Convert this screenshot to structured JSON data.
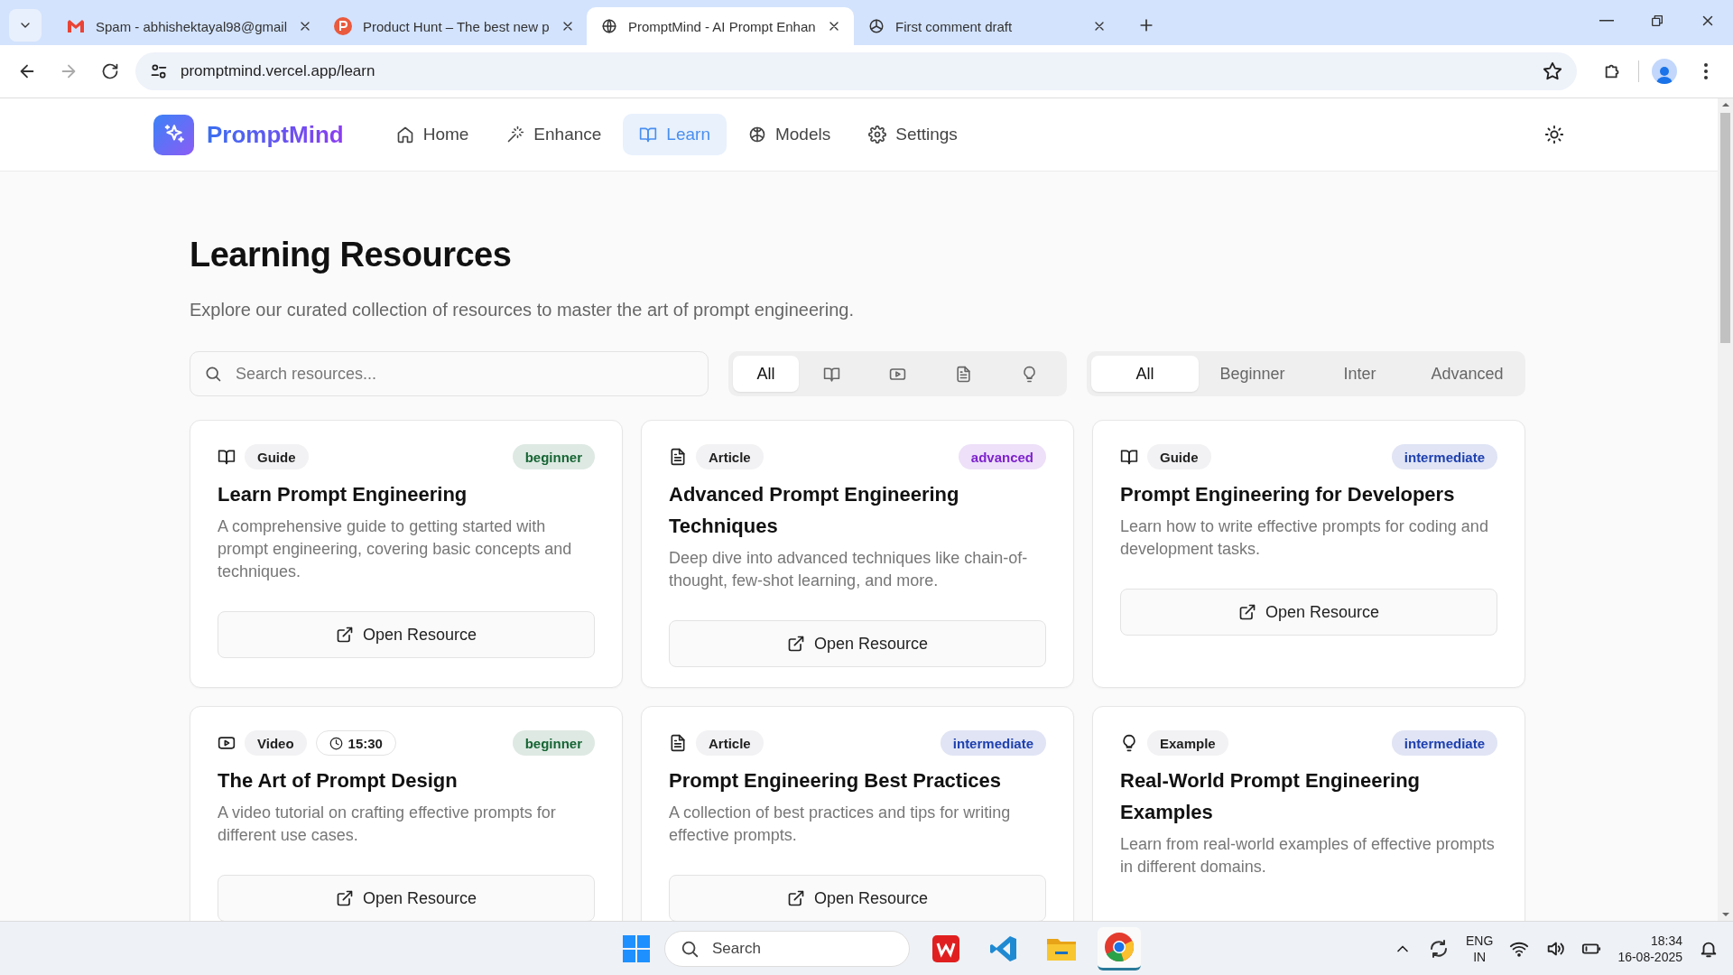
{
  "browser": {
    "tabs": [
      {
        "title": "Spam - abhishektayal98@gmail",
        "selected": false
      },
      {
        "title": "Product Hunt – The best new p",
        "selected": false
      },
      {
        "title": "PromptMind - AI Prompt Enhan",
        "selected": true
      },
      {
        "title": "First comment draft",
        "selected": false
      }
    ],
    "url": "promptmind.vercel.app/learn"
  },
  "app": {
    "brand": "PromptMind",
    "nav": [
      {
        "label": "Home",
        "selected": false
      },
      {
        "label": "Enhance",
        "selected": false
      },
      {
        "label": "Learn",
        "selected": true
      },
      {
        "label": "Models",
        "selected": false
      },
      {
        "label": "Settings",
        "selected": false
      }
    ]
  },
  "heading": "Learning Resources",
  "subtitle": "Explore our curated collection of resources to master the art of prompt engineering.",
  "search": {
    "placeholder": "Search resources..."
  },
  "type_filters": [
    {
      "kind": "text",
      "label": "All",
      "selected": true
    },
    {
      "kind": "book",
      "selected": false
    },
    {
      "kind": "video",
      "selected": false
    },
    {
      "kind": "doc",
      "selected": false
    },
    {
      "kind": "bulb",
      "selected": false
    }
  ],
  "level_filters": [
    {
      "label": "All",
      "selected": true
    },
    {
      "label": "Beginner",
      "selected": false
    },
    {
      "label": "Inter",
      "selected": false
    },
    {
      "label": "Advanced",
      "selected": false
    }
  ],
  "resources": [
    {
      "kind": "book",
      "type": "Guide",
      "level": "beginner",
      "color": "#166534",
      "title": "Learn Prompt Engineering",
      "description": "A comprehensive guide to getting started with prompt engineering, covering basic concepts and techniques.",
      "button": "Open Resource"
    },
    {
      "kind": "doc",
      "type": "Article",
      "level": "advanced",
      "color": "#7e22ce",
      "title": "Advanced Prompt Engineering Techniques",
      "description": "Deep dive into advanced techniques like chain-of-thought, few-shot learning, and more.",
      "button": "Open Resource"
    },
    {
      "kind": "book",
      "type": "Guide",
      "level": "intermediate",
      "color": "#1e40af",
      "title": "Prompt Engineering for Developers",
      "description": "Learn how to write effective prompts for coding and development tasks.",
      "button": "Open Resource"
    },
    {
      "kind": "video",
      "type": "Video",
      "duration": "15:30",
      "level": "beginner",
      "color": "#166534",
      "title": "The Art of Prompt Design",
      "description": "A video tutorial on crafting effective prompts for different use cases.",
      "button": "Open Resource"
    },
    {
      "kind": "doc",
      "type": "Article",
      "level": "intermediate",
      "color": "#1e40af",
      "title": "Prompt Engineering Best Practices",
      "description": "A collection of best practices and tips for writing effective prompts.",
      "button": "Open Resource"
    },
    {
      "kind": "bulb",
      "type": "Example",
      "level": "intermediate",
      "color": "#1e40af",
      "title": "Real-World Prompt Engineering Examples",
      "description": "Learn from real-world examples of effective prompts in different domains."
    }
  ],
  "taskbar": {
    "search_placeholder": "Search",
    "language": "ENG",
    "region": "IN",
    "time": "18:34",
    "date": "16-08-2025"
  }
}
